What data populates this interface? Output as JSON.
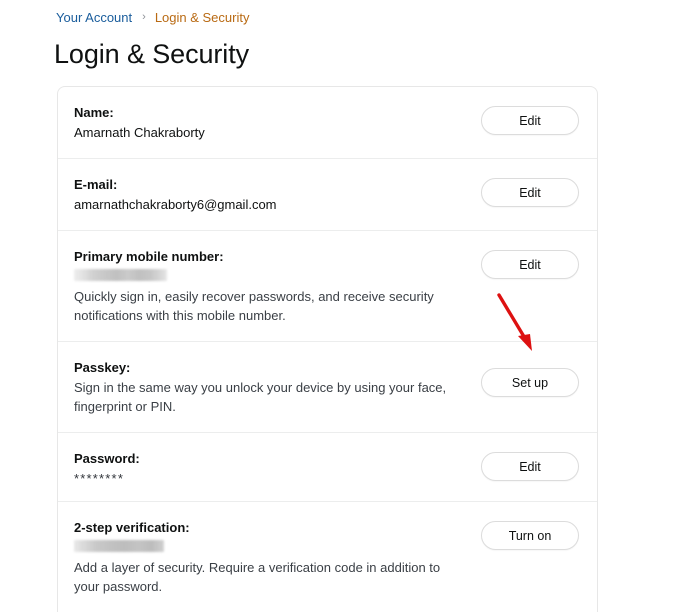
{
  "breadcrumb": {
    "parent_label": "Your Account",
    "separator": "›",
    "current_label": "Login & Security"
  },
  "page": {
    "title": "Login & Security"
  },
  "colors": {
    "link_blue": "#1a5d9c",
    "breadcrumb_current_orange": "#b96a13",
    "text_primary": "#0f1111",
    "card_border": "#e7e7e7",
    "row_divider": "#eceded",
    "button_border": "#dcdcdc",
    "annotation_red": "#dd1111"
  },
  "rows": [
    {
      "label": "Name:",
      "value": "Amarnath Chakraborty",
      "description": "",
      "button_label": "Edit"
    },
    {
      "label": "E-mail:",
      "value": "amarnathchakraborty6@gmail.com",
      "description": "",
      "button_label": "Edit"
    },
    {
      "label": "Primary mobile number:",
      "value": "",
      "description": "Quickly sign in, easily recover passwords, and receive security notifications with this mobile number.",
      "button_label": "Edit"
    },
    {
      "label": "Passkey:",
      "value": "",
      "description": "Sign in the same way you unlock your device by using your face, fingerprint or PIN.",
      "button_label": "Set up"
    },
    {
      "label": "Password:",
      "value": "********",
      "description": "",
      "button_label": "Edit"
    },
    {
      "label": "2-step verification:",
      "value": "",
      "description": "Add a layer of security. Require a verification code in addition to your password.",
      "button_label": "Turn on"
    }
  ],
  "annotation": {
    "type": "arrow",
    "points_to": "Set up"
  }
}
